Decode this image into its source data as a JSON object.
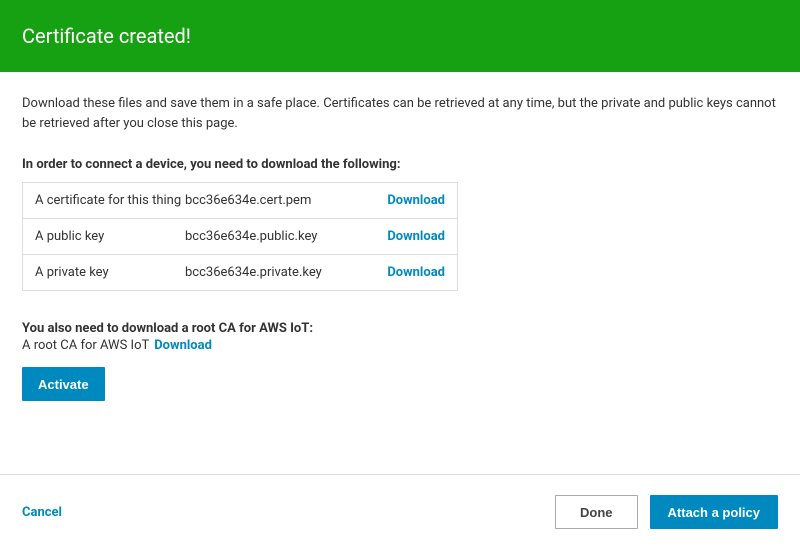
{
  "header": {
    "title": "Certificate created!"
  },
  "intro": "Download these files and save them in a safe place. Certificates can be retrieved at any time, but the private and public keys cannot be retrieved after you close this page.",
  "instruction": "In order to connect a device, you need to download the following:",
  "downloads": [
    {
      "label": "A certificate for this thing",
      "file": "bcc36e634e.cert.pem",
      "link_text": "Download"
    },
    {
      "label": "A public key",
      "file": "bcc36e634e.public.key",
      "link_text": "Download"
    },
    {
      "label": "A private key",
      "file": "bcc36e634e.private.key",
      "link_text": "Download"
    }
  ],
  "root_ca": {
    "heading": "You also need to download a root CA for AWS IoT:",
    "text": "A root CA for AWS IoT",
    "link_text": "Download"
  },
  "buttons": {
    "activate": "Activate",
    "cancel": "Cancel",
    "done": "Done",
    "attach": "Attach a policy"
  },
  "colors": {
    "banner": "#16a113",
    "primary": "#0089bf"
  }
}
